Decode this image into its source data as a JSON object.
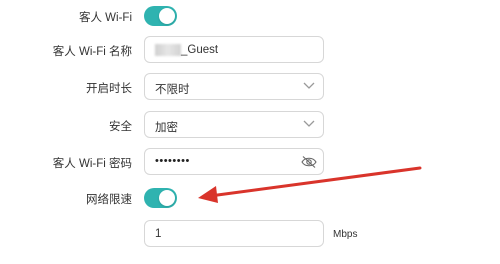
{
  "rows": {
    "guest_wifi": {
      "label": "客人 Wi-Fi",
      "enabled": true
    },
    "guest_name": {
      "label": "客人 Wi-Fi 名称",
      "value": "_Guest"
    },
    "open_duration": {
      "label": "开启时长",
      "value": "不限时"
    },
    "security": {
      "label": "安全",
      "value": "加密"
    },
    "password": {
      "label": "客人 Wi-Fi 密码",
      "value": "••••••••"
    },
    "rate_limit": {
      "label": "网络限速",
      "enabled": true
    },
    "speed": {
      "value": "1",
      "unit": "Mbps"
    }
  },
  "colors": {
    "toggle_on": "#2fb3b0",
    "arrow": "#d9342b"
  }
}
